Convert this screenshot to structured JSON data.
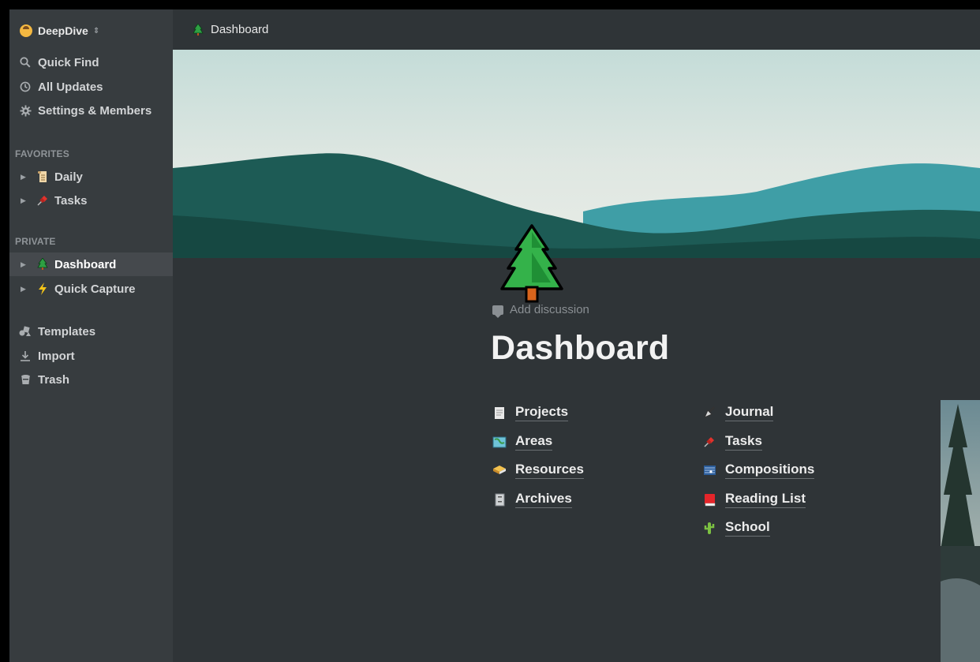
{
  "workspace": {
    "name": "DeepDive",
    "switcher_icon": "chevron-up-down-icon"
  },
  "sidebar": {
    "top_items": [
      {
        "label": "Quick Find",
        "icon": "search-icon"
      },
      {
        "label": "All Updates",
        "icon": "clock-icon"
      },
      {
        "label": "Settings & Members",
        "icon": "gear-icon"
      }
    ],
    "favorites_heading": "FAVORITES",
    "favorites": [
      {
        "label": "Daily",
        "icon": "scroll-icon"
      },
      {
        "label": "Tasks",
        "icon": "pushpin-icon"
      }
    ],
    "private_heading": "PRIVATE",
    "private": [
      {
        "label": "Dashboard",
        "icon": "evergreen-tree-icon",
        "active": true
      },
      {
        "label": "Quick Capture",
        "icon": "lightning-icon"
      }
    ],
    "bottom_items": [
      {
        "label": "Templates",
        "icon": "templates-icon"
      },
      {
        "label": "Import",
        "icon": "import-icon"
      },
      {
        "label": "Trash",
        "icon": "trash-icon"
      }
    ]
  },
  "breadcrumb": {
    "label": "Dashboard",
    "icon": "evergreen-tree-icon"
  },
  "page": {
    "add_discussion": "Add discussion",
    "title": "Dashboard",
    "links_left": [
      {
        "label": "Projects",
        "icon": "page-icon"
      },
      {
        "label": "Areas",
        "icon": "map-icon"
      },
      {
        "label": "Resources",
        "icon": "books-icon"
      },
      {
        "label": "Archives",
        "icon": "file-cabinet-icon"
      }
    ],
    "links_right": [
      {
        "label": "Journal",
        "icon": "fountain-pen-icon"
      },
      {
        "label": "Tasks",
        "icon": "pushpin-icon"
      },
      {
        "label": "Compositions",
        "icon": "musical-score-icon"
      },
      {
        "label": "Reading List",
        "icon": "red-book-icon"
      },
      {
        "label": "School",
        "icon": "cactus-icon"
      }
    ]
  },
  "colors": {
    "sidebar_bg": "#373c3f",
    "main_bg": "#2f3437",
    "active_item_bg": "#45494d"
  }
}
